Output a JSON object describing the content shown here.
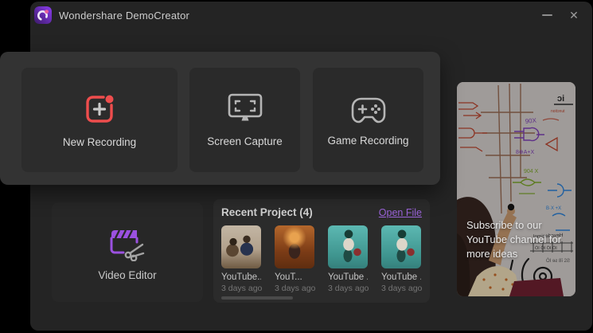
{
  "window": {
    "title": "Wondershare DemoCreator"
  },
  "controls": {
    "minimize": "–",
    "close": "✕"
  },
  "actions": {
    "new_recording": "New Recording",
    "screen_capture": "Screen Capture",
    "game_recording": "Game Recording",
    "video_editor": "Video Editor"
  },
  "recent": {
    "title": "Recent Project (4)",
    "open_file_label": "Open File",
    "projects": [
      {
        "name": "YouTube...",
        "age": "3 days ago"
      },
      {
        "name": "YouT...",
        "age": "3 days ago"
      },
      {
        "name": "YouTube ..",
        "age": "3 days ago"
      },
      {
        "name": "YouTube ..",
        "age": "3 days ago"
      }
    ]
  },
  "promo": {
    "line1": "Subscribe to our",
    "line2": "YouTube channel for",
    "line3": "more ideas"
  },
  "colors": {
    "accent_red": "#ee4d4d",
    "accent_purple": "#9b51e0",
    "link_purple": "#9a63d8",
    "window_bg": "#242424",
    "panel_bg": "#333333",
    "card_bg": "#2a2a2a"
  }
}
